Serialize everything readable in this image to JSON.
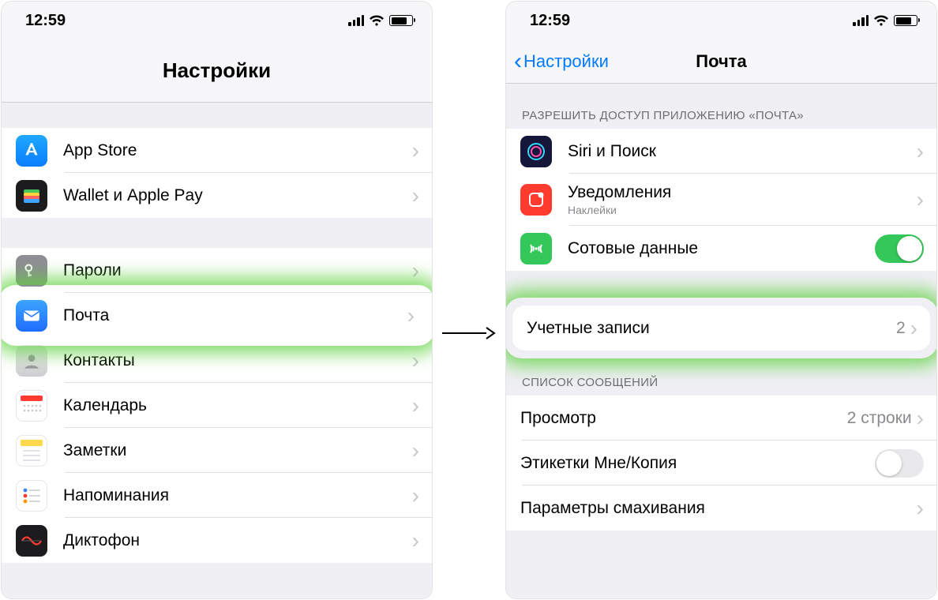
{
  "status": {
    "time": "12:59"
  },
  "left": {
    "title": "Настройки",
    "group1": [
      {
        "key": "appstore",
        "label": "App Store"
      },
      {
        "key": "wallet",
        "label": "Wallet и Apple Pay"
      }
    ],
    "group2": [
      {
        "key": "passwords",
        "label": "Пароли"
      },
      {
        "key": "mail",
        "label": "Почта",
        "highlighted": true
      },
      {
        "key": "contacts",
        "label": "Контакты"
      },
      {
        "key": "calendar",
        "label": "Календарь"
      },
      {
        "key": "notes",
        "label": "Заметки"
      },
      {
        "key": "reminders",
        "label": "Напоминания"
      },
      {
        "key": "voicememo",
        "label": "Диктофон"
      }
    ]
  },
  "right": {
    "back": "Настройки",
    "title": "Почта",
    "section1_header": "РАЗРЕШИТЬ ДОСТУП ПРИЛОЖЕНИЮ «ПОЧТА»",
    "rows1": {
      "siri": {
        "label": "Siri и Поиск"
      },
      "notif": {
        "label": "Уведомления",
        "sub": "Наклейки"
      },
      "cellular": {
        "label": "Сотовые данные",
        "toggle_on": true
      }
    },
    "accounts": {
      "label": "Учетные записи",
      "value": "2"
    },
    "section2_header": "СПИСОК СООБЩЕНИЙ",
    "rows2": {
      "preview": {
        "label": "Просмотр",
        "value": "2 строки"
      },
      "tocc": {
        "label": "Этикетки Мне/Копия",
        "toggle_on": false
      },
      "swipe": {
        "label": "Параметры смахивания"
      }
    }
  }
}
